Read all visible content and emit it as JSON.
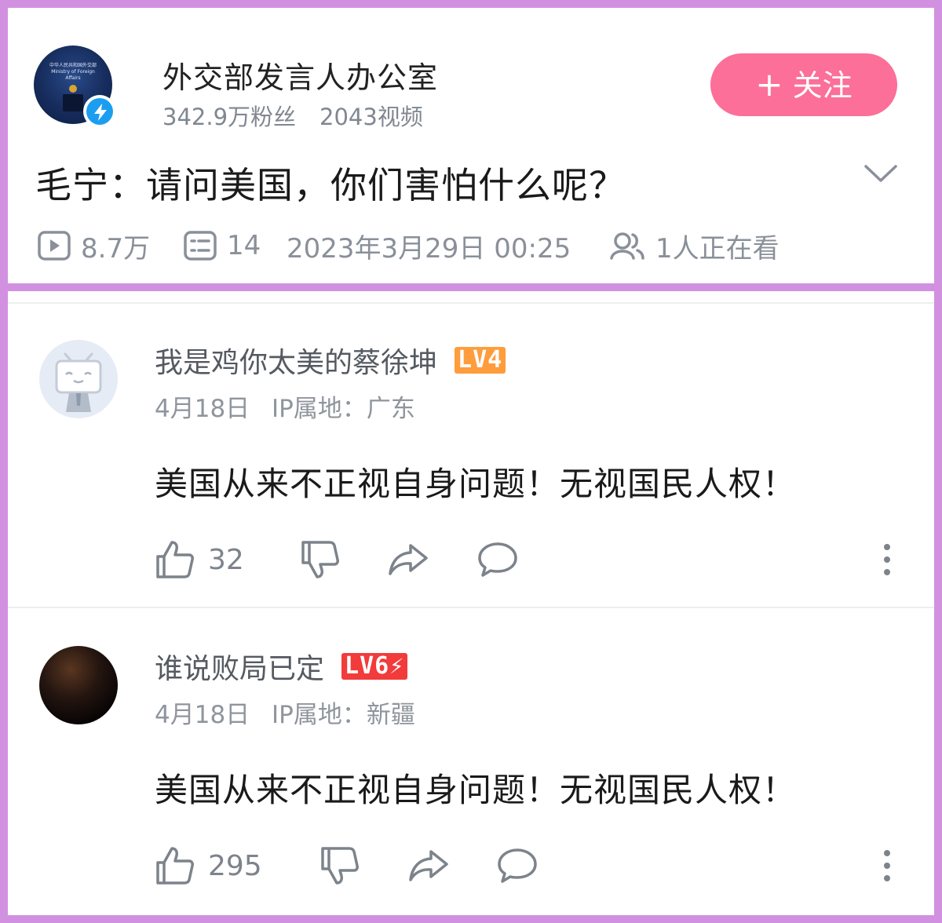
{
  "uploader": {
    "name": "外交部发言人办公室",
    "followers": "342.9万粉丝",
    "videos": "2043视频",
    "avatar_caption": "中华人民共和国外交部\nMinistry of Foreign Affairs",
    "follow_label": "关注",
    "follow_plus": "+"
  },
  "video": {
    "title": "毛宁：请问美国，你们害怕什么呢？",
    "views": "8.7万",
    "danmaku": "14",
    "published": "2023年3月29日 00:25",
    "watching": "1人正在看"
  },
  "comments": [
    {
      "user": "我是鸡你太美的蔡徐坤",
      "level": "LV4",
      "date": "4月18日",
      "ip": "IP属地：广东",
      "text": "美国从来不正视自身问题！无视国民人权！",
      "likes": "32"
    },
    {
      "user": "谁说败局已定",
      "level": "LV6⚡",
      "date": "4月18日",
      "ip": "IP属地：新疆",
      "text": "美国从来不正视自身问题！无视国民人权！",
      "likes": "295"
    }
  ],
  "colors": {
    "frame": "#d291e0",
    "follow_button": "#fb6f98",
    "verified": "#1c9ef0",
    "lv4": "#ff9c3b",
    "lv6": "#f23b3b"
  }
}
